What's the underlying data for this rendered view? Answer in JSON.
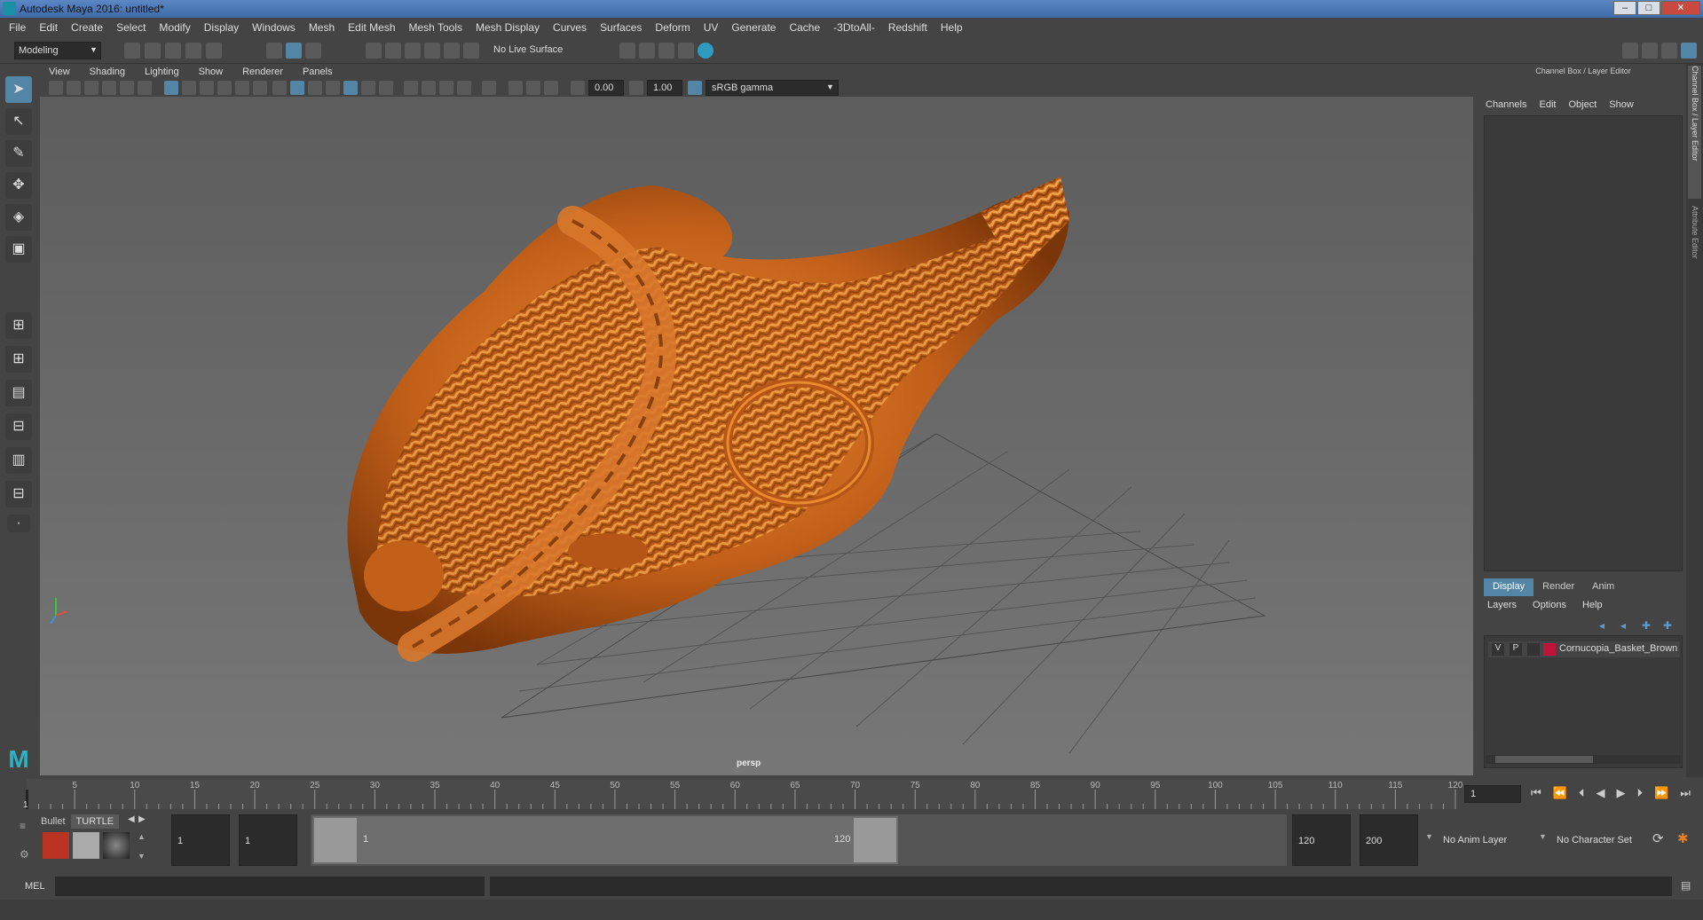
{
  "window": {
    "title": "Autodesk Maya 2016: untitled*"
  },
  "menu": [
    "File",
    "Edit",
    "Create",
    "Select",
    "Modify",
    "Display",
    "Windows",
    "Mesh",
    "Edit Mesh",
    "Mesh Tools",
    "Mesh Display",
    "Curves",
    "Surfaces",
    "Deform",
    "UV",
    "Generate",
    "Cache",
    "-3DtoAll-",
    "Redshift",
    "Help"
  ],
  "toolbar": {
    "mode": "Modeling",
    "live_surface": "No Live Surface"
  },
  "panel_menu": [
    "View",
    "Shading",
    "Lighting",
    "Show",
    "Renderer",
    "Panels"
  ],
  "panel_toolbar": {
    "exposure": "0.00",
    "gamma": "1.00",
    "colorspace": "sRGB gamma"
  },
  "viewport": {
    "camera_label": "persp"
  },
  "channel_box": {
    "title": "Channel Box / Layer Editor",
    "menu": [
      "Channels",
      "Edit",
      "Object",
      "Show"
    ]
  },
  "side_tabs": {
    "channel": "Channel Box / Layer Editor",
    "attribute": "Attribute Editor"
  },
  "layer_editor": {
    "tabs": [
      "Display",
      "Render",
      "Anim"
    ],
    "menu": [
      "Layers",
      "Options",
      "Help"
    ],
    "layer": {
      "v": "V",
      "p": "P",
      "name": "Cornucopia_Basket_Brown",
      "color": "#c0143c"
    }
  },
  "timeline": {
    "ticks": [
      "5",
      "10",
      "15",
      "20",
      "25",
      "30",
      "35",
      "40",
      "45",
      "50",
      "55",
      "60",
      "65",
      "70",
      "75",
      "80",
      "85",
      "90",
      "95",
      "100",
      "105",
      "110",
      "115",
      "120"
    ],
    "start_tick": "1",
    "current_frame": "1"
  },
  "shelf_tabs": [
    "Bullet",
    "TURTLE"
  ],
  "range": {
    "start": "1",
    "inner_start": "1",
    "slider_start": "1",
    "slider_end": "120",
    "end": "120",
    "anim_end": "200",
    "anim_layer": "No Anim Layer",
    "character_set": "No Character Set"
  },
  "mel": {
    "label": "MEL"
  },
  "colors": {
    "accent": "#5285a6",
    "basket": "#c2601a",
    "viewport_bg": "#6a6a6a"
  }
}
